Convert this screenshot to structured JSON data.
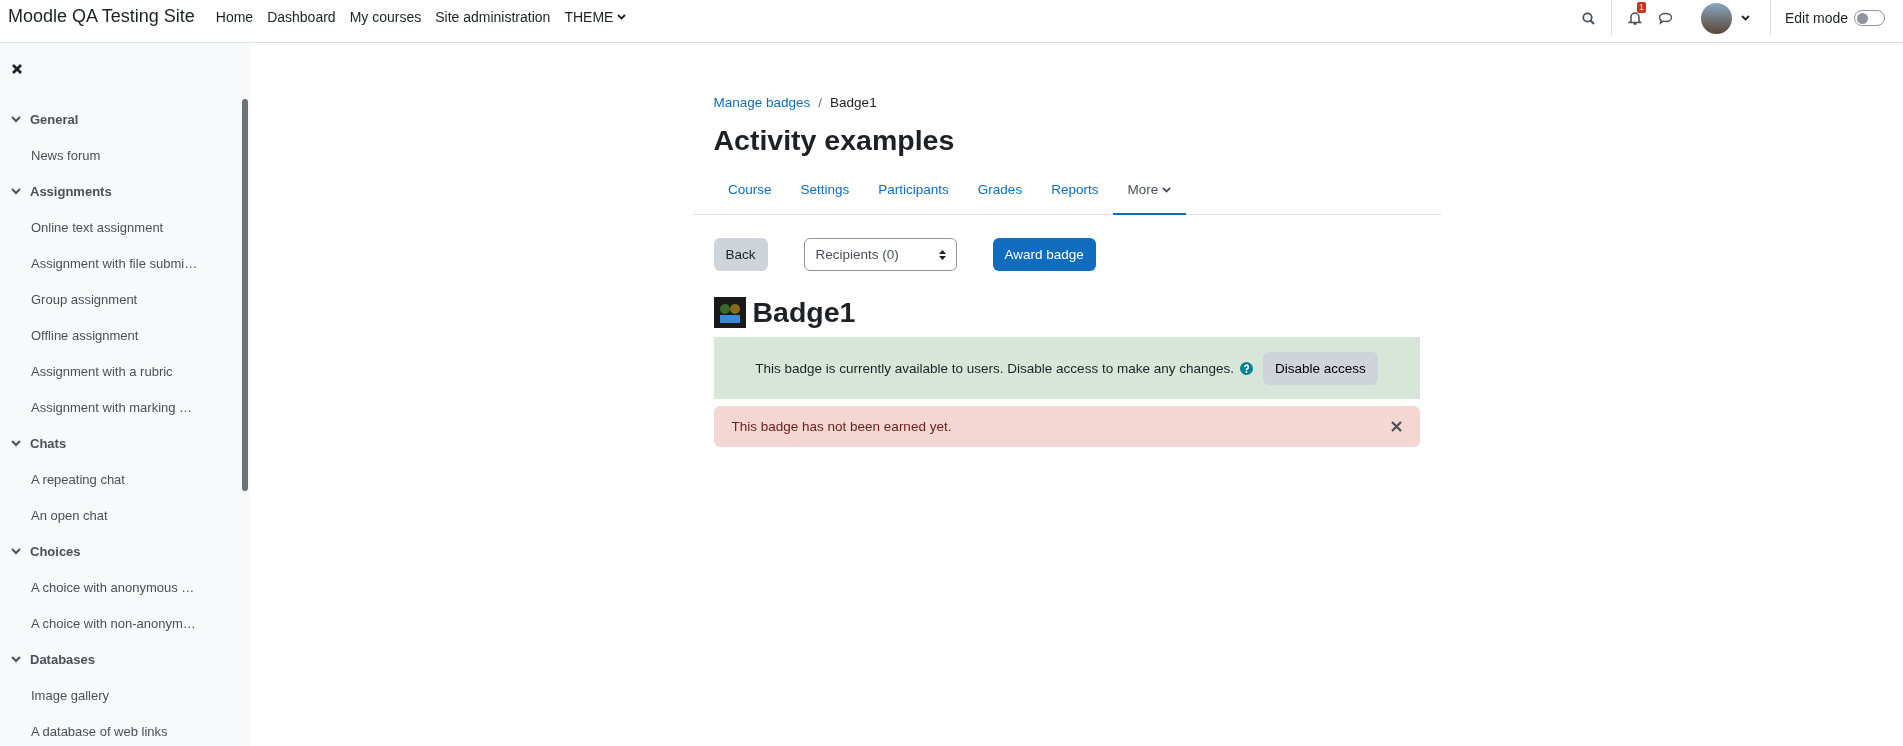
{
  "navbar": {
    "brand": "Moodle QA Testing Site",
    "links": [
      {
        "label": "Home",
        "dropdown": false
      },
      {
        "label": "Dashboard",
        "dropdown": false
      },
      {
        "label": "My courses",
        "dropdown": false
      },
      {
        "label": "Site administration",
        "dropdown": false
      },
      {
        "label": "THEME",
        "dropdown": true
      }
    ],
    "notification_count": "1",
    "edit_mode": {
      "label": "Edit mode",
      "on": false
    }
  },
  "sidebar": {
    "sections": [
      {
        "title": "General",
        "expanded": true,
        "children": [
          {
            "label": "News forum"
          }
        ]
      },
      {
        "title": "Assignments",
        "expanded": true,
        "children": [
          {
            "label": "Online text assignment"
          },
          {
            "label": "Assignment with file submi…"
          },
          {
            "label": "Group assignment"
          },
          {
            "label": "Offline assignment"
          },
          {
            "label": "Assignment with a rubric"
          },
          {
            "label": "Assignment with marking …"
          }
        ]
      },
      {
        "title": "Chats",
        "expanded": true,
        "children": [
          {
            "label": "A repeating chat"
          },
          {
            "label": "An open chat"
          }
        ]
      },
      {
        "title": "Choices",
        "expanded": true,
        "children": [
          {
            "label": "A choice with anonymous …"
          },
          {
            "label": "A choice with non-anonym…"
          }
        ]
      },
      {
        "title": "Databases",
        "expanded": true,
        "children": [
          {
            "label": "Image gallery"
          },
          {
            "label": "A database of web links"
          }
        ]
      }
    ]
  },
  "breadcrumb": [
    {
      "label": "Manage badges",
      "link": true
    },
    {
      "label": "Badge1",
      "link": false
    }
  ],
  "breadcrumb_separator": "/",
  "page_title": "Activity examples",
  "tabs": [
    {
      "label": "Course",
      "selected": false,
      "dropdown": false
    },
    {
      "label": "Settings",
      "selected": false,
      "dropdown": false
    },
    {
      "label": "Participants",
      "selected": false,
      "dropdown": false
    },
    {
      "label": "Grades",
      "selected": false,
      "dropdown": false
    },
    {
      "label": "Reports",
      "selected": false,
      "dropdown": false
    },
    {
      "label": "More",
      "selected": true,
      "dropdown": true
    }
  ],
  "actions": {
    "back": "Back",
    "recipients": "Recipients (0)",
    "award": "Award badge"
  },
  "badge_title": "Badge1",
  "alerts": [
    {
      "kind": "success",
      "text": "This badge is currently available to users. Disable access to make any changes.",
      "button": "Disable access"
    },
    {
      "kind": "danger",
      "text": "This badge has not been earned yet.",
      "dismissible": true
    }
  ]
}
